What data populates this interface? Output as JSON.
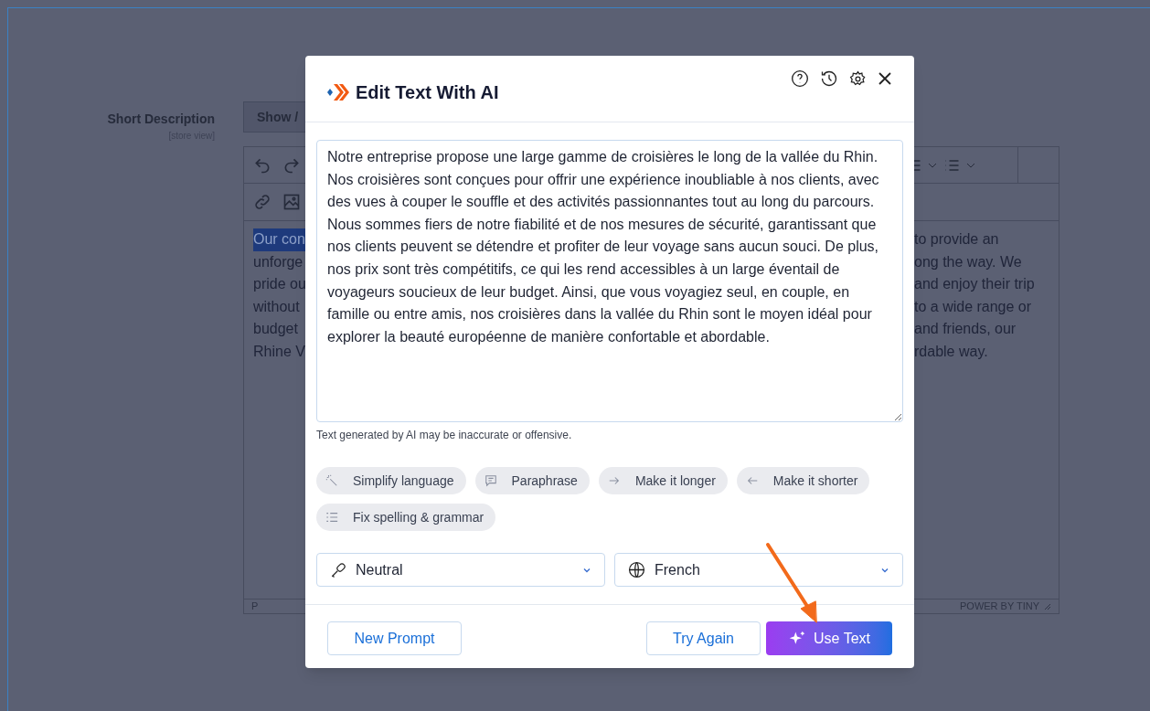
{
  "page": {
    "field_label": "Short Description",
    "field_scope": "[store view]",
    "show_button": "Show / "
  },
  "editor": {
    "content_left": [
      {
        "text": "Our con",
        "selected": true
      },
      {
        "text": "unforge",
        "selected": false
      },
      {
        "text": "pride ou",
        "selected": false
      },
      {
        "text": "without",
        "selected": false
      },
      {
        "text": "budget",
        "selected": false
      },
      {
        "text": "Rhine V",
        "selected": false
      }
    ],
    "content_right": [
      "to provide an",
      "ong the way. We",
      "and enjoy their trip",
      "to a wide range or",
      "and friends, our",
      "rdable way."
    ],
    "status_path": "P",
    "branding": "POWER BY TINY"
  },
  "modal": {
    "title": "Edit Text With AI",
    "text": "Notre entreprise propose une large gamme de croisières le long de la vallée du Rhin. Nos croisières sont conçues pour offrir une expérience inoubliable à nos clients, avec des vues à couper le souffle et des activités passionnantes tout au long du parcours. Nous sommes fiers de notre fiabilité et de nos mesures de sécurité, garantissant que nos clients peuvent se détendre et profiter de leur voyage sans aucun souci. De plus, nos prix sont très compétitifs, ce qui les rend accessibles à un large éventail de voyageurs soucieux de leur budget. Ainsi, que vous voyagiez seul, en couple, en famille ou entre amis, nos croisières dans la vallée du Rhin sont le moyen idéal pour explorer la beauté européenne de manière confortable et abordable.",
    "disclaimer": "Text generated by AI may be inaccurate or offensive.",
    "actions": [
      {
        "kind": "simplify",
        "label": "Simplify language"
      },
      {
        "kind": "paraphrase",
        "label": "Paraphrase"
      },
      {
        "kind": "longer",
        "label": "Make it longer"
      },
      {
        "kind": "shorter",
        "label": "Make it shorter"
      },
      {
        "kind": "fix",
        "label": "Fix spelling & grammar"
      }
    ],
    "tone": {
      "value": "Neutral"
    },
    "language": {
      "value": "French"
    },
    "buttons": {
      "new_prompt": "New Prompt",
      "try_again": "Try Again",
      "use_text": "Use Text"
    }
  }
}
